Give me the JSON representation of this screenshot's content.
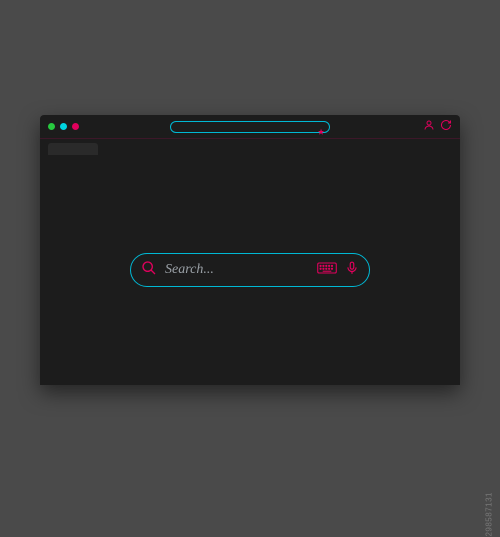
{
  "window": {
    "controls": {
      "green": "#27c93f",
      "cyan": "#00d4e0",
      "magenta": "#e0005c"
    }
  },
  "colors": {
    "accent_cyan": "#00b8d4",
    "accent_magenta": "#e0005c",
    "bg_dark": "#1c1c1c",
    "page_bg": "#4a4a4a"
  },
  "search": {
    "placeholder": "Search..."
  },
  "icons": {
    "star": "star-icon",
    "user": "user-icon",
    "refresh": "refresh-icon",
    "search": "search-icon",
    "keyboard": "keyboard-icon",
    "microphone": "microphone-icon"
  },
  "watermark": "298587131"
}
